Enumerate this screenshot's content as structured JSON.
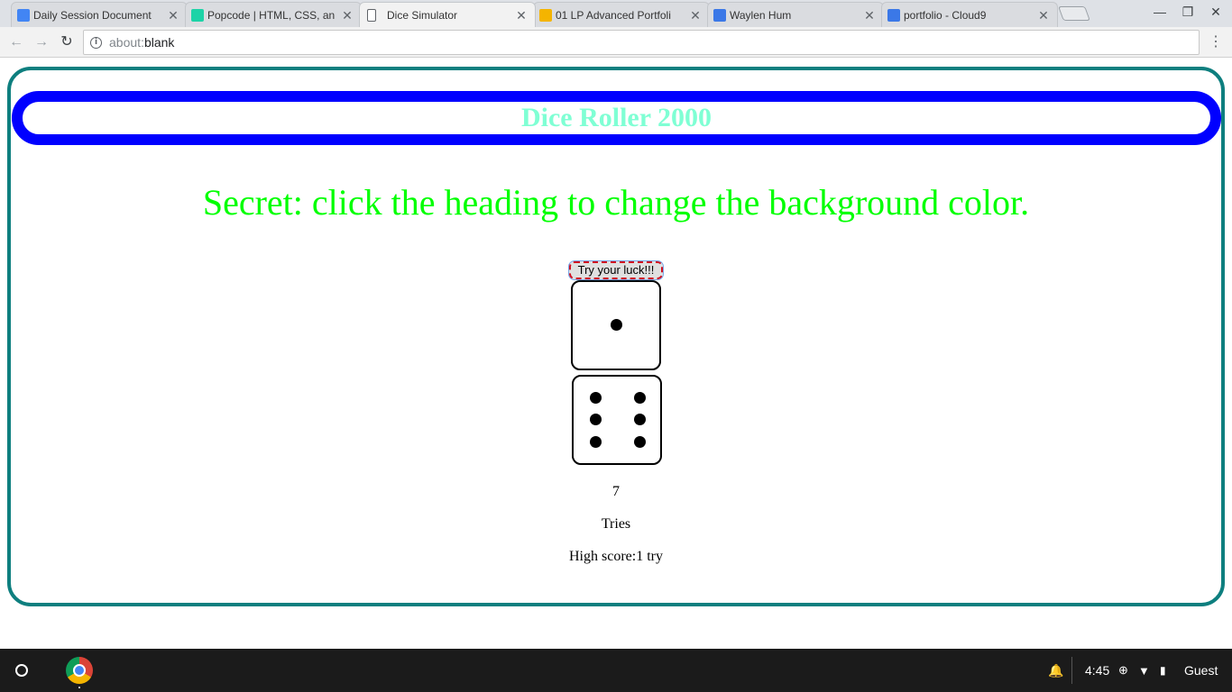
{
  "browser": {
    "tabs": [
      {
        "title": "Daily Session Document",
        "favicon_color": "#4285f4",
        "icon": "docs-icon"
      },
      {
        "title": "Popcode | HTML, CSS, an",
        "favicon_color": "#1dd3a7",
        "icon": "popcode-icon"
      },
      {
        "title": "Dice Simulator",
        "favicon_color": "#ffffff",
        "icon": "page-icon",
        "active": true
      },
      {
        "title": "01 LP Advanced Portfoli",
        "favicon_color": "#f4b400",
        "icon": "slides-icon"
      },
      {
        "title": "Waylen Hum",
        "favicon_color": "#3b78e7",
        "icon": "cloud9-icon"
      },
      {
        "title": "portfolio - Cloud9",
        "favicon_color": "#3b78e7",
        "icon": "cloud9-icon"
      }
    ],
    "tab_close_glyph": "✕",
    "url_scheme": "about:",
    "url_host": "blank",
    "window_controls": {
      "minimize": "—",
      "restore": "❐",
      "close": "✕"
    }
  },
  "page": {
    "heading": "Dice Roller 2000",
    "secret": "Secret: click the heading to change the background color.",
    "roll_button": "Try your luck!!!",
    "dice": [
      {
        "value": 1
      },
      {
        "value": 6
      }
    ],
    "total": "7",
    "tries_label": "Tries",
    "high_score": "High score:1 try",
    "colors": {
      "frame_border": "#0e7f7f",
      "heading_bar_border": "#0000ff",
      "heading_text": "#7fffd4",
      "secret_text": "#00ff00"
    }
  },
  "shelf": {
    "time": "4:45",
    "user": "Guest",
    "icons": [
      "launcher-icon",
      "chrome-icon",
      "notification-icon",
      "update-icon",
      "wifi-icon",
      "battery-icon"
    ]
  }
}
